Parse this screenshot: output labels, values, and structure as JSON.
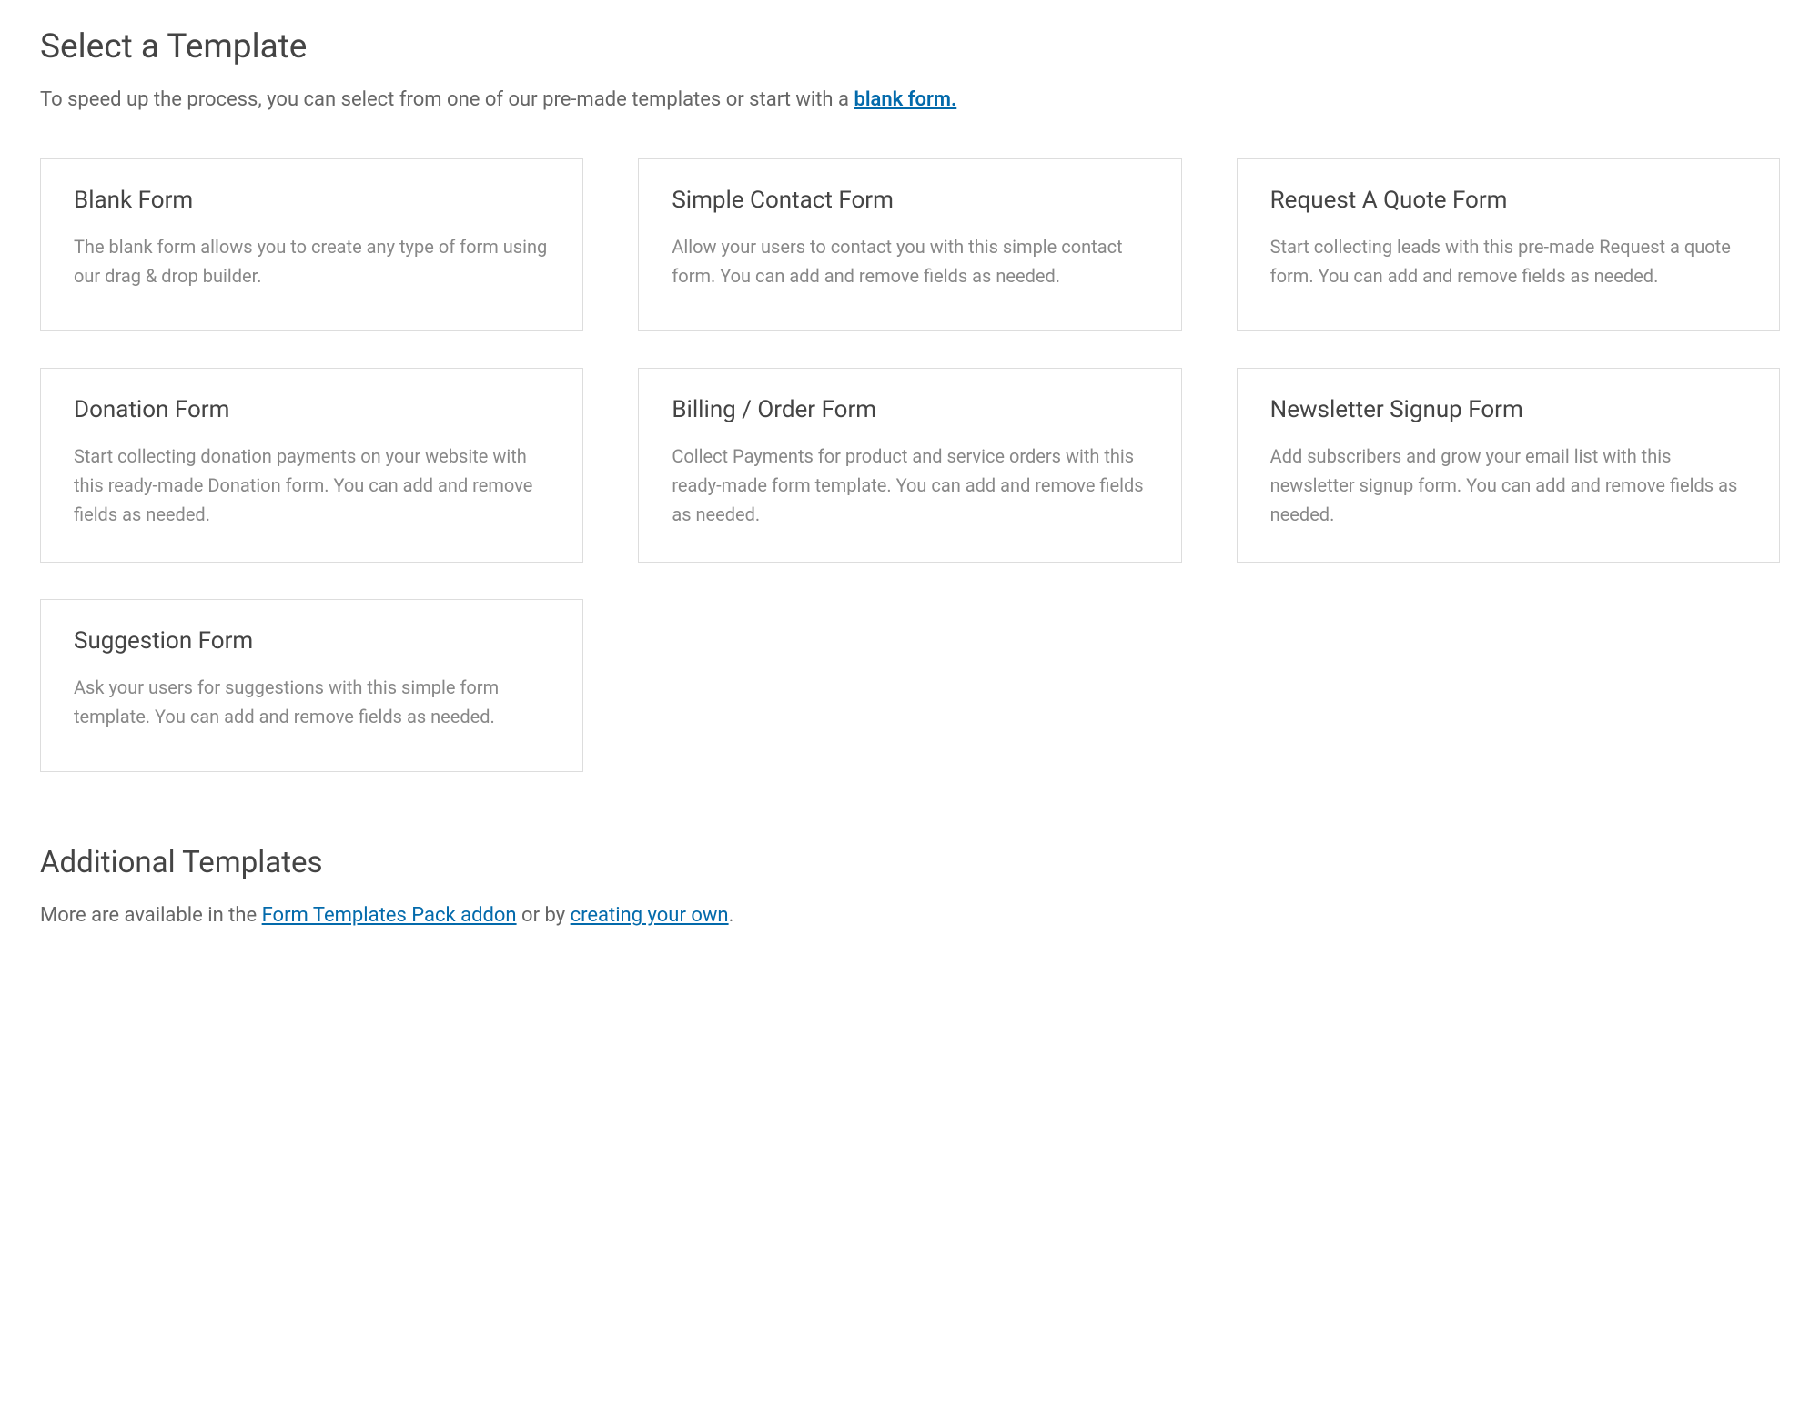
{
  "header": {
    "title": "Select a Template",
    "intro_prefix": "To speed up the process, you can select from one of our pre-made templates or start with a ",
    "blank_link": "blank form."
  },
  "templates": [
    {
      "title": "Blank Form",
      "desc": "The blank form allows you to create any type of form using our drag & drop builder."
    },
    {
      "title": "Simple Contact Form",
      "desc": "Allow your users to contact you with this simple contact form. You can add and remove fields as needed."
    },
    {
      "title": "Request A Quote Form",
      "desc": "Start collecting leads with this pre-made Request a quote form. You can add and remove fields as needed."
    },
    {
      "title": "Donation Form",
      "desc": "Start collecting donation payments on your website with this ready-made Donation form. You can add and remove fields as needed."
    },
    {
      "title": "Billing / Order Form",
      "desc": "Collect Payments for product and service orders with this ready-made form template. You can add and remove fields as needed."
    },
    {
      "title": "Newsletter Signup Form",
      "desc": "Add subscribers and grow your email list with this newsletter signup form. You can add and remove fields as needed."
    },
    {
      "title": "Suggestion Form",
      "desc": "Ask your users for suggestions with this simple form template. You can add and remove fields as needed."
    }
  ],
  "additional": {
    "title": "Additional Templates",
    "text_prefix": "More are available in the ",
    "link1": "Form Templates Pack addon",
    "text_mid": " or by ",
    "link2": "creating your own",
    "text_suffix": "."
  }
}
